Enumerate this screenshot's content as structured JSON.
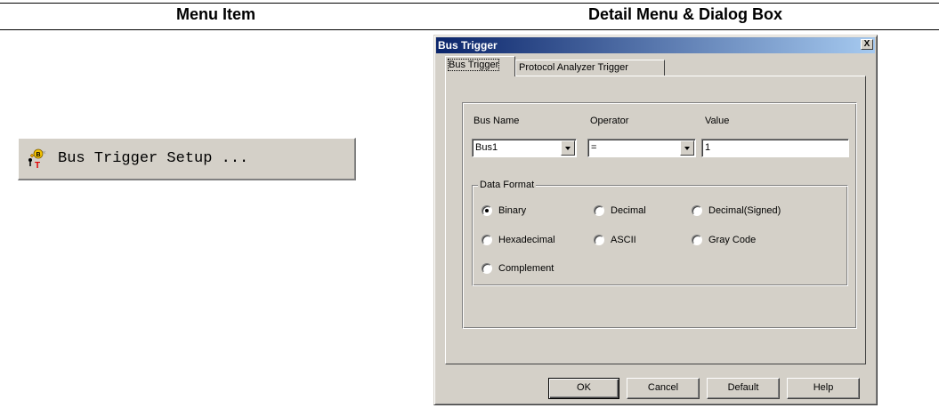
{
  "table": {
    "col_menu_item": "Menu Item",
    "col_detail": "Detail Menu & Dialog Box"
  },
  "menu_item": {
    "label": "Bus Trigger Setup ...",
    "icon": "bus-trigger-icon"
  },
  "dialog": {
    "title": "Bus Trigger",
    "close_label": "X",
    "tabs": [
      {
        "label": "Bus Trigger",
        "active": true
      },
      {
        "label": "Protocol Analyzer Trigger",
        "active": false
      }
    ],
    "bus_name_label": "Bus Name",
    "operator_label": "Operator",
    "value_label": "Value",
    "bus_name_value": "Bus1",
    "operator_value": "=",
    "value_value": "1",
    "data_format": {
      "legend": "Data Format",
      "options": [
        {
          "label": "Binary",
          "checked": true
        },
        {
          "label": "Decimal",
          "checked": false
        },
        {
          "label": "Decimal(Signed)",
          "checked": false
        },
        {
          "label": "Hexadecimal",
          "checked": false
        },
        {
          "label": "ASCII",
          "checked": false
        },
        {
          "label": "Gray Code",
          "checked": false
        },
        {
          "label": "Complement",
          "checked": false
        }
      ]
    },
    "buttons": {
      "ok": "OK",
      "cancel": "Cancel",
      "default": "Default",
      "help": "Help"
    }
  }
}
